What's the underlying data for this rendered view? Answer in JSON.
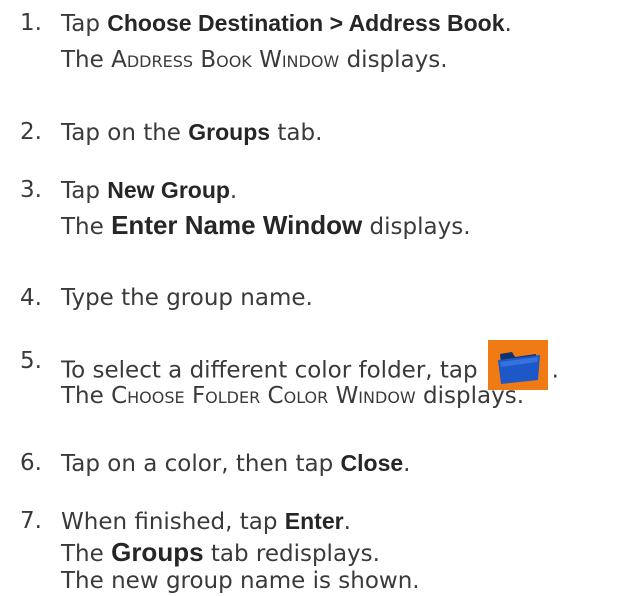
{
  "steps": [
    {
      "number": "1.",
      "line1": {
        "pre": "Tap ",
        "bold": "Choose Destination > Address Book",
        "post": "."
      },
      "line2": {
        "pre": "The ",
        "smallcaps": "Address Book Window",
        "post": " displays."
      }
    },
    {
      "number": "2.",
      "line1": {
        "pre": "Tap on the ",
        "bold": "Groups",
        "post": " tab."
      }
    },
    {
      "number": "3.",
      "line1": {
        "pre": "Tap ",
        "bold": "New Group",
        "post": "."
      },
      "line2": {
        "pre": "The ",
        "bold": "Enter Name Window",
        "post": " displays."
      }
    },
    {
      "number": "4.",
      "line1": {
        "text": "Type the group name."
      }
    },
    {
      "number": "5.",
      "line1": {
        "pre": "To select a different color folder, tap",
        "post": "."
      },
      "icon": "blue-folder-icon",
      "line2": {
        "pre": "The ",
        "smallcaps": "Choose Folder Color Window",
        "post": " displays."
      }
    },
    {
      "number": "6.",
      "line1": {
        "pre": "Tap on a color, then tap ",
        "bold": "Close",
        "post": "."
      }
    },
    {
      "number": "7.",
      "line1": {
        "pre": "When finished, tap ",
        "bold": "Enter",
        "post": "."
      },
      "line2": {
        "pre": "The ",
        "bold": "Groups",
        "post": " tab redisplays."
      },
      "line3": {
        "text": "The new group name is shown."
      }
    }
  ],
  "colors": {
    "text": "#3a3a3a",
    "icon_background": "#f07a14",
    "folder_blue": "#1d57c8"
  }
}
